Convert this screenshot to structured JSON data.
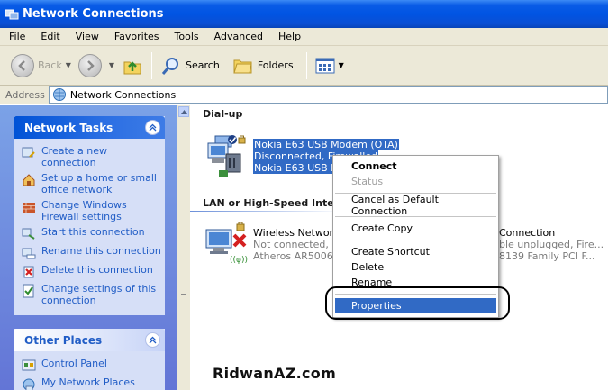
{
  "window": {
    "title": "Network Connections"
  },
  "menu": [
    "File",
    "Edit",
    "View",
    "Favorites",
    "Tools",
    "Advanced",
    "Help"
  ],
  "toolbar": {
    "back_label": "Back",
    "search_label": "Search",
    "folders_label": "Folders"
  },
  "address": {
    "label": "Address",
    "value": "Network Connections"
  },
  "network_tasks": {
    "title": "Network Tasks",
    "items": [
      {
        "label": "Create a new connection",
        "icon": "new-connection-icon"
      },
      {
        "label": "Set up a home or small office network",
        "icon": "home-network-icon"
      },
      {
        "label": "Change Windows Firewall settings",
        "icon": "firewall-icon"
      },
      {
        "label": "Start this connection",
        "icon": "start-connection-icon"
      },
      {
        "label": "Rename this connection",
        "icon": "rename-icon"
      },
      {
        "label": "Delete this connection",
        "icon": "delete-icon"
      },
      {
        "label": "Change settings of this connection",
        "icon": "settings-icon"
      }
    ]
  },
  "other_places": {
    "title": "Other Places",
    "items": [
      {
        "label": "Control Panel",
        "icon": "control-panel-icon"
      },
      {
        "label": "My Network Places",
        "icon": "network-places-icon"
      }
    ]
  },
  "dialup": {
    "header": "Dial-up",
    "item": {
      "line1": "Nokia E63 USB Modem (OTA)",
      "line2": "Disconnected, Firewalled",
      "line3": "Nokia E63 USB Modem"
    }
  },
  "lan": {
    "header": "LAN or High-Speed Internet",
    "wireless": {
      "line1": "Wireless Network Connection",
      "line2": "Not connected, Firewalled",
      "line3": "Atheros AR5006X Wireless Network Adapter"
    },
    "local": {
      "line1": "Connection",
      "line2": "ble unplugged, Fire...",
      "line3": "8139 Family PCI F..."
    }
  },
  "context_menu": {
    "items": [
      {
        "label": "Connect",
        "style": "bold"
      },
      {
        "label": "Status",
        "style": "disabled"
      },
      {
        "sep": true
      },
      {
        "label": "Cancel as Default Connection"
      },
      {
        "sep": true
      },
      {
        "label": "Create Copy"
      },
      {
        "sep": true
      },
      {
        "label": "Create Shortcut"
      },
      {
        "label": "Delete"
      },
      {
        "label": "Rename"
      },
      {
        "sep": true
      },
      {
        "label": "Properties",
        "style": "highlighted"
      }
    ]
  },
  "watermark": "RidwanAZ.com",
  "colors": {
    "title_bar": "#0054e3",
    "selection": "#316ac5",
    "task_link": "#215dc6"
  }
}
